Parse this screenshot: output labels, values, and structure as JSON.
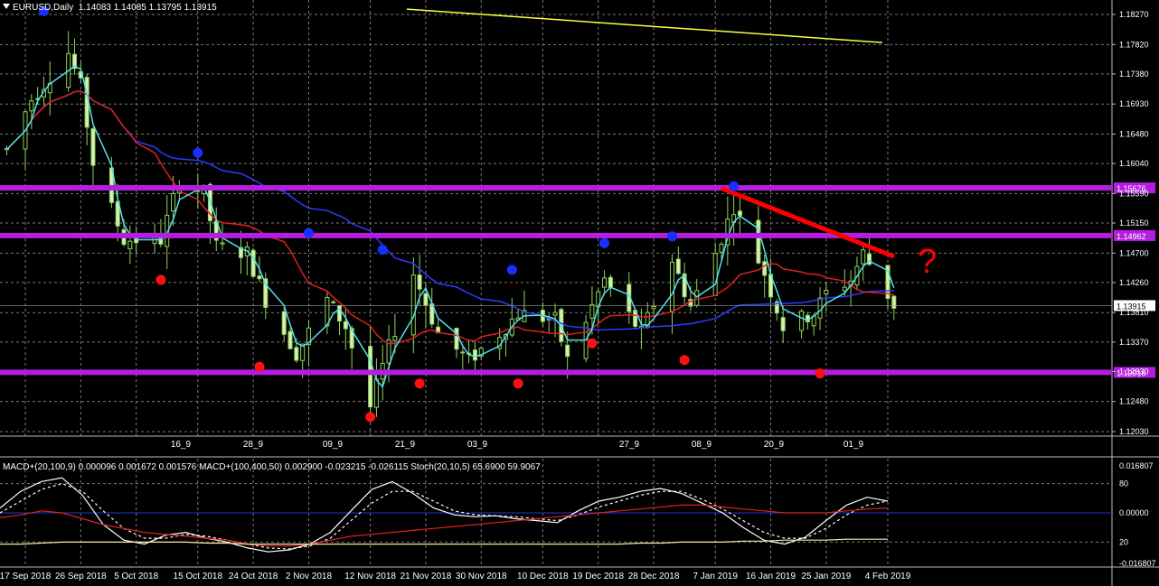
{
  "window": {
    "symbol_label": "EURUSD,Daily",
    "ohlc": "1.14083 1.14085 1.13795 1.13915"
  },
  "indicator_header": "MACD+(20,100,9) 0.000096 0.001672 0.001576  MACD+(100,400,50) 0.002900 -0.023215 -0.026115  Stoch(20,10,5) 65.6900 59.9067",
  "colors": {
    "background": "#000000",
    "grid": "#7a7a7a",
    "bull_candle": "#8fd45a",
    "bear_candle": "#d8f0b0",
    "ma_fast": "#4fe3ef",
    "ma_mid": "#e02020",
    "ma_slow": "#2a3cff",
    "ma_long": "#ffff40",
    "level_line": "#b41ee0",
    "trend_line": "#ff0000",
    "fractal_up": "#1830ff",
    "fractal_down": "#ff1010"
  },
  "annotation": {
    "question_mark": "?"
  },
  "chart_data": [
    {
      "type": "candlestick",
      "title": "EURUSD,Daily",
      "ylim": [
        1.1185,
        1.129
      ],
      "y_ticks": [
        "1.18270",
        "1.17820",
        "1.17380",
        "1.16930",
        "1.16480",
        "1.16040",
        "1.15590",
        "1.15150",
        "1.14700",
        "1.14260",
        "1.13810",
        "1.13370",
        "1.12930",
        "1.12480",
        "1.12030"
      ],
      "current_price": "1.13915",
      "levels": [
        {
          "label": "1.15676",
          "value": 1.15676
        },
        {
          "label": "1.14962",
          "value": 1.14962
        },
        {
          "label": "1.12916",
          "value": 1.12916
        }
      ],
      "trend_line": {
        "from": {
          "date": "8 Jan 2019",
          "price": 1.1567
        },
        "to": {
          "date": "5 Feb 2019",
          "price": 1.1465
        }
      },
      "sub_axis_labels": [
        "16_9",
        "28_9",
        "09_9",
        "21_9",
        "03_9",
        "27_9",
        "08_9",
        "20_9",
        "01_9"
      ],
      "x_tick_labels": [
        "17 Sep 2018",
        "26 Sep 2018",
        "5 Oct 2018",
        "15 Oct 2018",
        "24 Oct 2018",
        "2 Nov 2018",
        "12 Nov 2018",
        "21 Nov 2018",
        "30 Nov 2018",
        "10 Dec 2018",
        "19 Dec 2018",
        "28 Dec 2018",
        "7 Jan 2019",
        "16 Jan 2019",
        "25 Jan 2019",
        "4 Feb 2019"
      ],
      "approx_daily_close_anchors": [
        {
          "date": "14 Sep 2018",
          "close": 1.1625
        },
        {
          "date": "18 Sep 2018",
          "close": 1.17
        },
        {
          "date": "24 Sep 2018",
          "close": 1.177
        },
        {
          "date": "26 Sep 2018",
          "close": 1.172
        },
        {
          "date": "28 Sep 2018",
          "close": 1.1605
        },
        {
          "date": "3 Oct 2018",
          "close": 1.149
        },
        {
          "date": "9 Oct 2018",
          "close": 1.149
        },
        {
          "date": "12 Oct 2018",
          "close": 1.158
        },
        {
          "date": "16 Oct 2018",
          "close": 1.156
        },
        {
          "date": "18 Oct 2018",
          "close": 1.148
        },
        {
          "date": "23 Oct 2018",
          "close": 1.147
        },
        {
          "date": "26 Oct 2018",
          "close": 1.14
        },
        {
          "date": "31 Oct 2018",
          "close": 1.132
        },
        {
          "date": "5 Nov 2018",
          "close": 1.14
        },
        {
          "date": "8 Nov 2018",
          "close": 1.136
        },
        {
          "date": "12 Nov 2018",
          "close": 1.124
        },
        {
          "date": "14 Nov 2018",
          "close": 1.13
        },
        {
          "date": "19 Nov 2018",
          "close": 1.144
        },
        {
          "date": "23 Nov 2018",
          "close": 1.135
        },
        {
          "date": "28 Nov 2018",
          "close": 1.131
        },
        {
          "date": "3 Dec 2018",
          "close": 1.135
        },
        {
          "date": "6 Dec 2018",
          "close": 1.138
        },
        {
          "date": "12 Dec 2018",
          "close": 1.137
        },
        {
          "date": "14 Dec 2018",
          "close": 1.131
        },
        {
          "date": "20 Dec 2018",
          "close": 1.143
        },
        {
          "date": "26 Dec 2018",
          "close": 1.135
        },
        {
          "date": "31 Dec 2018",
          "close": 1.146
        },
        {
          "date": "3 Jan 2019",
          "close": 1.139
        },
        {
          "date": "7 Jan 2019",
          "close": 1.147
        },
        {
          "date": "10 Jan 2019",
          "close": 1.154
        },
        {
          "date": "15 Jan 2019",
          "close": 1.144
        },
        {
          "date": "18 Jan 2019",
          "close": 1.136
        },
        {
          "date": "23 Jan 2019",
          "close": 1.138
        },
        {
          "date": "25 Jan 2019",
          "close": 1.141
        },
        {
          "date": "29 Jan 2019",
          "close": 1.143
        },
        {
          "date": "31 Jan 2019",
          "close": 1.147
        },
        {
          "date": "5 Feb 2019",
          "close": 1.1392
        }
      ],
      "moving_averages_approx": [
        {
          "name": "MA fast",
          "color": "ma_fast",
          "values_at_anchors": "follows price closely"
        },
        {
          "name": "MA mid",
          "color": "ma_mid",
          "start": 1.163,
          "end": 1.141
        },
        {
          "name": "MA slow",
          "color": "ma_slow",
          "start": 1.164,
          "end": 1.1402
        },
        {
          "name": "MA long",
          "color": "ma_long",
          "start": 1.1835,
          "end": 1.1785
        }
      ],
      "fractals": {
        "up": [
          {
            "date": "20 Sep 2018",
            "price": 1.1832
          },
          {
            "date": "15 Oct 2018",
            "price": 1.162
          },
          {
            "date": "2 Nov 2018",
            "price": 1.15
          },
          {
            "date": "14 Nov 2018",
            "price": 1.1475
          },
          {
            "date": "5 Dec 2018",
            "price": 1.1445
          },
          {
            "date": "20 Dec 2018",
            "price": 1.1485
          },
          {
            "date": "31 Dec 2018",
            "price": 1.1495
          },
          {
            "date": "10 Jan 2019",
            "price": 1.157
          }
        ],
        "down": [
          {
            "date": "9 Oct 2018",
            "price": 1.143
          },
          {
            "date": "25 Oct 2018",
            "price": 1.13
          },
          {
            "date": "12 Nov 2018",
            "price": 1.1225
          },
          {
            "date": "20 Nov 2018",
            "price": 1.1275
          },
          {
            "date": "6 Dec 2018",
            "price": 1.1275
          },
          {
            "date": "18 Dec 2018",
            "price": 1.1335
          },
          {
            "date": "2 Jan 2019",
            "price": 1.131
          },
          {
            "date": "24 Jan 2019",
            "price": 1.129
          }
        ]
      }
    },
    {
      "type": "line",
      "title": "MACD+(20,100,9) 0.000096 0.001672 0.001576  MACD+(100,400,50) 0.002900 -0.023215 -0.026115  Stoch(20,10,5) 65.6900 59.9067",
      "y_ticks": [
        "0.016807",
        "80",
        "0.00000",
        "20",
        "-0.016807"
      ],
      "series": [
        {
          "name": "Stoch main",
          "color": "#ffffff",
          "values": [
            55,
            72,
            82,
            86,
            68,
            38,
            22,
            18,
            27,
            30,
            24,
            20,
            14,
            10,
            12,
            18,
            30,
            52,
            74,
            82,
            70,
            55,
            48,
            46,
            47,
            44,
            42,
            40,
            52,
            62,
            66,
            72,
            75,
            70,
            60,
            50,
            35,
            22,
            18,
            25,
            42,
            58,
            66,
            62
          ]
        },
        {
          "name": "Stoch signal",
          "color": "#ffffff",
          "dashed": true,
          "values": [
            50,
            62,
            74,
            80,
            72,
            52,
            34,
            24,
            24,
            28,
            26,
            22,
            18,
            14,
            13,
            16,
            24,
            42,
            60,
            72,
            72,
            62,
            52,
            48,
            47,
            46,
            44,
            42,
            48,
            56,
            62,
            68,
            72,
            72,
            64,
            54,
            42,
            30,
            24,
            24,
            34,
            48,
            58,
            62
          ]
        },
        {
          "name": "MACD red",
          "color": "#e02020",
          "values": [
            45,
            48,
            52,
            50,
            44,
            38,
            34,
            30,
            28,
            26,
            24,
            22,
            18,
            16,
            16,
            18,
            22,
            26,
            28,
            30,
            32,
            34,
            36,
            38,
            40,
            42,
            44,
            46,
            48,
            50,
            52,
            54,
            56,
            58,
            58,
            56,
            54,
            52,
            50,
            50,
            50,
            52,
            54,
            55
          ]
        },
        {
          "name": "MACD yellow",
          "color": "#ffe9a8",
          "values": [
            18,
            18,
            19,
            20,
            20,
            20,
            20,
            20,
            20,
            20,
            19,
            19,
            18,
            18,
            18,
            18,
            18,
            18,
            18,
            18,
            18,
            18,
            18,
            18,
            18,
            18,
            18,
            18,
            18,
            18,
            18,
            19,
            19,
            20,
            20,
            20,
            21,
            21,
            22,
            22,
            22,
            23,
            23,
            23
          ]
        }
      ]
    }
  ]
}
